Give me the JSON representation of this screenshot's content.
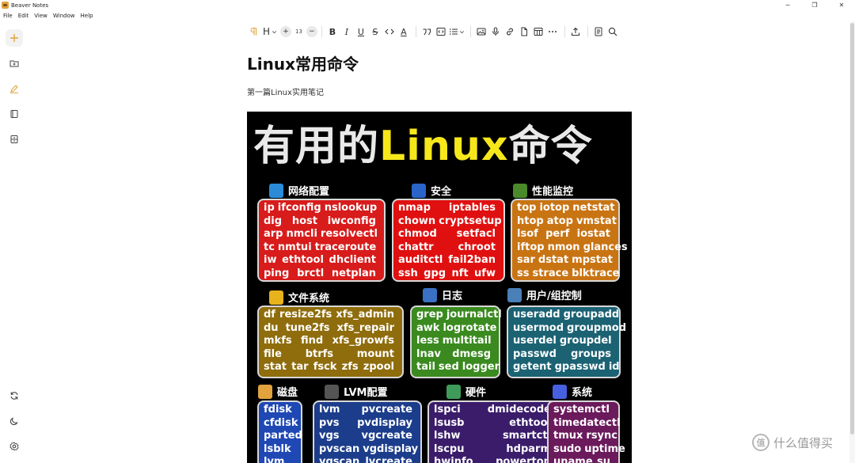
{
  "window": {
    "title": "Beaver Notes",
    "minimize": "─",
    "restore": "❐",
    "close": "✕"
  },
  "menu": [
    "File",
    "Edit",
    "View",
    "Window",
    "Help"
  ],
  "toolbar": {
    "heading_label": "H",
    "font_size": "13",
    "plus": "+",
    "minus": "−",
    "bold": "B",
    "italic": "I",
    "underline": "U",
    "strike": "S",
    "text_color_glyph": "A"
  },
  "document": {
    "title": "Linux常用命令",
    "subtitle": "第一篇Linux实用笔记"
  },
  "poster": {
    "title_white": "有用的",
    "title_yellow": "Linux",
    "title_white2": "命令",
    "sections": [
      {
        "title": "网络配置",
        "icon": "network-icon",
        "color": "#d81b1b",
        "rows": [
          [
            "ip",
            "ifconfig",
            "nslookup"
          ],
          [
            "dig",
            "host",
            "iwconfig"
          ],
          [
            "arp",
            "nmcli",
            "resolvectl"
          ],
          [
            "tc",
            "nmtui",
            "traceroute"
          ],
          [
            "iw",
            "ethtool",
            "dhclient"
          ],
          [
            "ping",
            "brctl",
            "netplan"
          ]
        ]
      },
      {
        "title": "安全",
        "icon": "shield-icon",
        "color": "#e01010",
        "rows": [
          [
            "nmap",
            "iptables"
          ],
          [
            "chown",
            "cryptsetup"
          ],
          [
            "chmod",
            "setfacl"
          ],
          [
            "chattr",
            "chroot"
          ],
          [
            "auditctl",
            "fail2ban"
          ],
          [
            "ssh",
            "gpg",
            "nft",
            "ufw"
          ]
        ]
      },
      {
        "title": "性能监控",
        "icon": "monitor-icon",
        "color": "#c97413",
        "rows": [
          [
            "top",
            "iotop",
            "netstat"
          ],
          [
            "htop",
            "atop",
            "vmstat"
          ],
          [
            "lsof",
            "perf",
            "iostat"
          ],
          [
            "iftop",
            "nmon",
            "glances"
          ],
          [
            "sar",
            "dstat",
            "mpstat"
          ],
          [
            "ss",
            "strace",
            "blktrace"
          ]
        ]
      },
      {
        "title": "文件系统",
        "icon": "folder-icon",
        "color": "#8f6d0c",
        "rows": [
          [
            "df",
            "resize2fs",
            "xfs_admin"
          ],
          [
            "du",
            "tune2fs",
            "xfs_repair"
          ],
          [
            "mkfs",
            "find",
            "xfs_growfs"
          ],
          [
            "file",
            "btrfs",
            "mount"
          ],
          [
            "stat",
            "tar",
            "fsck",
            "zfs",
            "zpool"
          ]
        ]
      },
      {
        "title": "日志",
        "icon": "log-icon",
        "color": "#3a8a1f",
        "rows": [
          [
            "grep",
            "journalctl"
          ],
          [
            "awk",
            "logrotate"
          ],
          [
            "less",
            "multitail"
          ],
          [
            "lnav",
            "dmesg"
          ],
          [
            "tail",
            "sed",
            "logger"
          ]
        ]
      },
      {
        "title": "用户/组控制",
        "icon": "user-group-icon",
        "color": "#1b6273",
        "rows": [
          [
            "useradd",
            "groupadd"
          ],
          [
            "usermod",
            "groupmod"
          ],
          [
            "userdel",
            "groupdel"
          ],
          [
            "passwd",
            "groups"
          ],
          [
            "getent",
            "gpasswd",
            "id"
          ]
        ]
      },
      {
        "title": "磁盘",
        "icon": "disk-icon",
        "color": "#1f48b5",
        "rows": [
          [
            "fdisk"
          ],
          [
            "cfdisk"
          ],
          [
            "parted"
          ],
          [
            "lsblk"
          ],
          [
            "lvm"
          ]
        ]
      },
      {
        "title": "LVM配置",
        "icon": "lvm-icon",
        "color": "#1c3d8c",
        "rows": [
          [
            "lvm",
            "pvcreate"
          ],
          [
            "pvs",
            "pvdisplay"
          ],
          [
            "vgs",
            "vgcreate"
          ],
          [
            "pvscan",
            "vgdisplay"
          ],
          [
            "vgscan",
            "lvcreate"
          ]
        ]
      },
      {
        "title": "硬件",
        "icon": "hardware-icon",
        "color": "#3a1c6b",
        "rows": [
          [
            "lspci",
            "dmidecode"
          ],
          [
            "lsusb",
            "ethtool"
          ],
          [
            "lshw",
            "smartctl"
          ],
          [
            "lscpu",
            "hdparm"
          ],
          [
            "hwinfo",
            "powertop"
          ]
        ]
      },
      {
        "title": "系统",
        "icon": "system-icon",
        "color": "#6b1a5c",
        "rows": [
          [
            "systemctl"
          ],
          [
            "timedatectl"
          ],
          [
            "tmux",
            "rsync"
          ],
          [
            "sudo",
            "uptime"
          ],
          [
            "uname",
            "su"
          ]
        ]
      }
    ]
  },
  "watermark": {
    "badge": "值",
    "text": "什么值得买"
  }
}
